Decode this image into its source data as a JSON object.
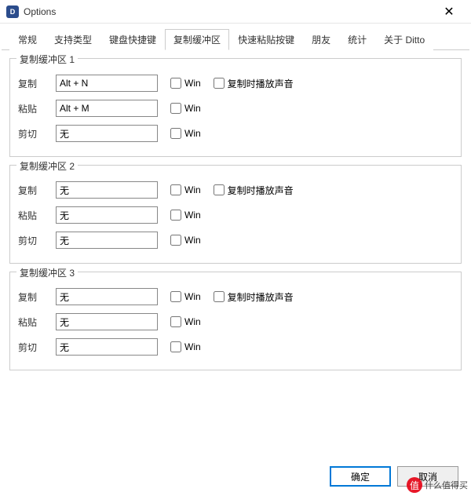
{
  "window": {
    "title": "Options"
  },
  "tabs": [
    "常规",
    "支持类型",
    "键盘快捷键",
    "复制缓冲区",
    "快速粘贴按键",
    "朋友",
    "统计",
    "关于 Ditto"
  ],
  "activeTabIndex": 3,
  "groups": [
    {
      "title": "复制缓冲区 1",
      "rows": [
        {
          "label": "复制",
          "value": "Alt + N",
          "winLabel": "Win",
          "playSoundLabel": "复制时播放声音",
          "showPlaySound": true
        },
        {
          "label": "粘贴",
          "value": "Alt + M",
          "winLabel": "Win",
          "showPlaySound": false
        },
        {
          "label": "剪切",
          "value": "无",
          "winLabel": "Win",
          "showPlaySound": false
        }
      ]
    },
    {
      "title": "复制缓冲区 2",
      "rows": [
        {
          "label": "复制",
          "value": "无",
          "winLabel": "Win",
          "playSoundLabel": "复制时播放声音",
          "showPlaySound": true
        },
        {
          "label": "粘贴",
          "value": "无",
          "winLabel": "Win",
          "showPlaySound": false
        },
        {
          "label": "剪切",
          "value": "无",
          "winLabel": "Win",
          "showPlaySound": false
        }
      ]
    },
    {
      "title": "复制缓冲区 3",
      "rows": [
        {
          "label": "复制",
          "value": "无",
          "winLabel": "Win",
          "playSoundLabel": "复制时播放声音",
          "showPlaySound": true
        },
        {
          "label": "粘贴",
          "value": "无",
          "winLabel": "Win",
          "showPlaySound": false
        },
        {
          "label": "剪切",
          "value": "无",
          "winLabel": "Win",
          "showPlaySound": false
        }
      ]
    }
  ],
  "buttons": {
    "ok": "确定",
    "cancel": "取消"
  },
  "watermark": {
    "icon": "值",
    "text": "什么值得买"
  }
}
